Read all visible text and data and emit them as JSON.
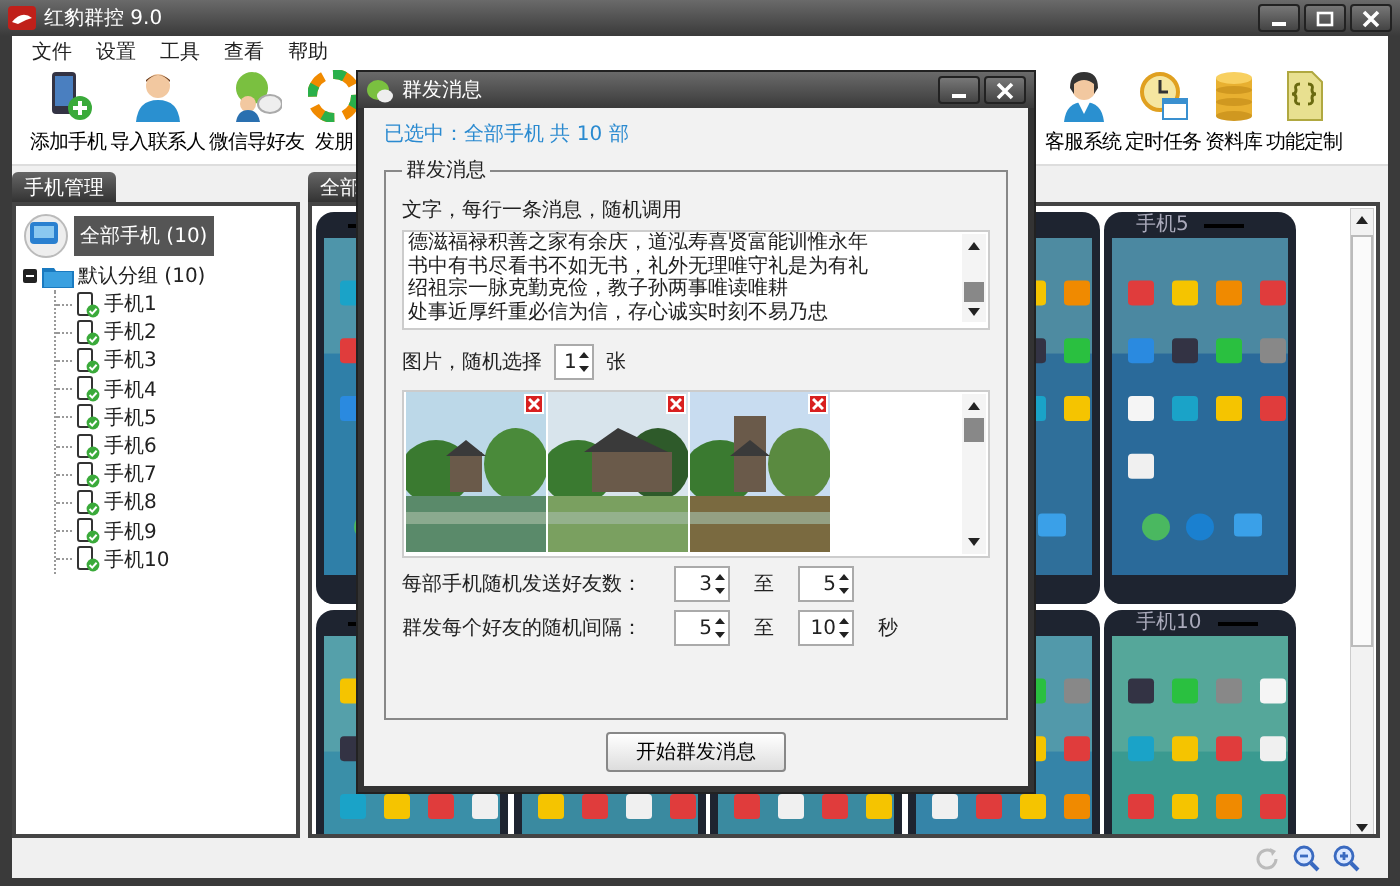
{
  "window": {
    "title": "红豹群控 9.0"
  },
  "menu": [
    "文件",
    "设置",
    "工具",
    "查看",
    "帮助"
  ],
  "toolbar_left": [
    {
      "label": "添加手机",
      "kind": "phone"
    },
    {
      "label": "导入联系人",
      "kind": "person"
    },
    {
      "label": "微信导好友",
      "kind": "chat"
    },
    {
      "label": "发朋",
      "kind": "ring"
    }
  ],
  "toolbar_right": [
    {
      "label": "客服系统",
      "kind": "agent"
    },
    {
      "label": "定时任务",
      "kind": "clock"
    },
    {
      "label": "资料库",
      "kind": "database"
    },
    {
      "label": "功能定制",
      "kind": "code"
    }
  ],
  "left_panel": {
    "tab": "手机管理",
    "root": {
      "label": "全部手机 (10)",
      "selected": true
    },
    "group": {
      "label": "默认分组 (10)",
      "expanded": true,
      "children": [
        {
          "label": "手机1"
        },
        {
          "label": "手机2"
        },
        {
          "label": "手机3"
        },
        {
          "label": "手机4"
        },
        {
          "label": "手机5"
        },
        {
          "label": "手机6"
        },
        {
          "label": "手机7"
        },
        {
          "label": "手机8"
        },
        {
          "label": "手机9"
        },
        {
          "label": "手机10"
        }
      ]
    }
  },
  "right_panel": {
    "tab": "全部",
    "phones": [
      {
        "kind": "phone",
        "color": "#2f7fa8"
      },
      {
        "kind": "slot"
      },
      {
        "kind": "slot"
      },
      {
        "kind": "phone",
        "color": "#2f6f9a"
      },
      {
        "kind": "phone",
        "label": "手机5",
        "color": "#2a6a9a"
      },
      {
        "kind": "phone",
        "color": "#3a8fa8"
      },
      {
        "kind": "phone"
      },
      {
        "kind": "phone"
      },
      {
        "kind": "phone",
        "color": "#3584a8"
      },
      {
        "kind": "phone",
        "label": "手机10",
        "color": "#3a9a90"
      }
    ]
  },
  "dialog": {
    "title": "群发消息",
    "selection": "已选中：全部手机 共 10 部",
    "group_title": "群发消息",
    "text_label": "文字，每行一条消息，随机调用",
    "messages": [
      "德滋福禄积善之家有余庆，道泓寿喜贤富能训惟永年",
      "书中有书尽看书不如无书，礼外无理唯守礼是为有礼",
      "绍祖宗一脉克勤克俭，教子孙两事唯读唯耕",
      "处事近厚纤重必信为信，存心诚实时刻不易乃忠"
    ],
    "image_label": "图片，随机选择",
    "image_count": "1",
    "image_unit": "张",
    "images": [
      {
        "kind": "picture"
      },
      {
        "kind": "picture"
      },
      {
        "kind": "picture"
      }
    ],
    "friends": {
      "label": "每部手机随机发送好友数：",
      "from": "3",
      "to_word": "至",
      "to": "5"
    },
    "interval": {
      "label": "群发每个好友的随机间隔：",
      "from": "5",
      "to_word": "至",
      "to": "10",
      "unit": "秒"
    },
    "start_button": "开始群发消息"
  }
}
